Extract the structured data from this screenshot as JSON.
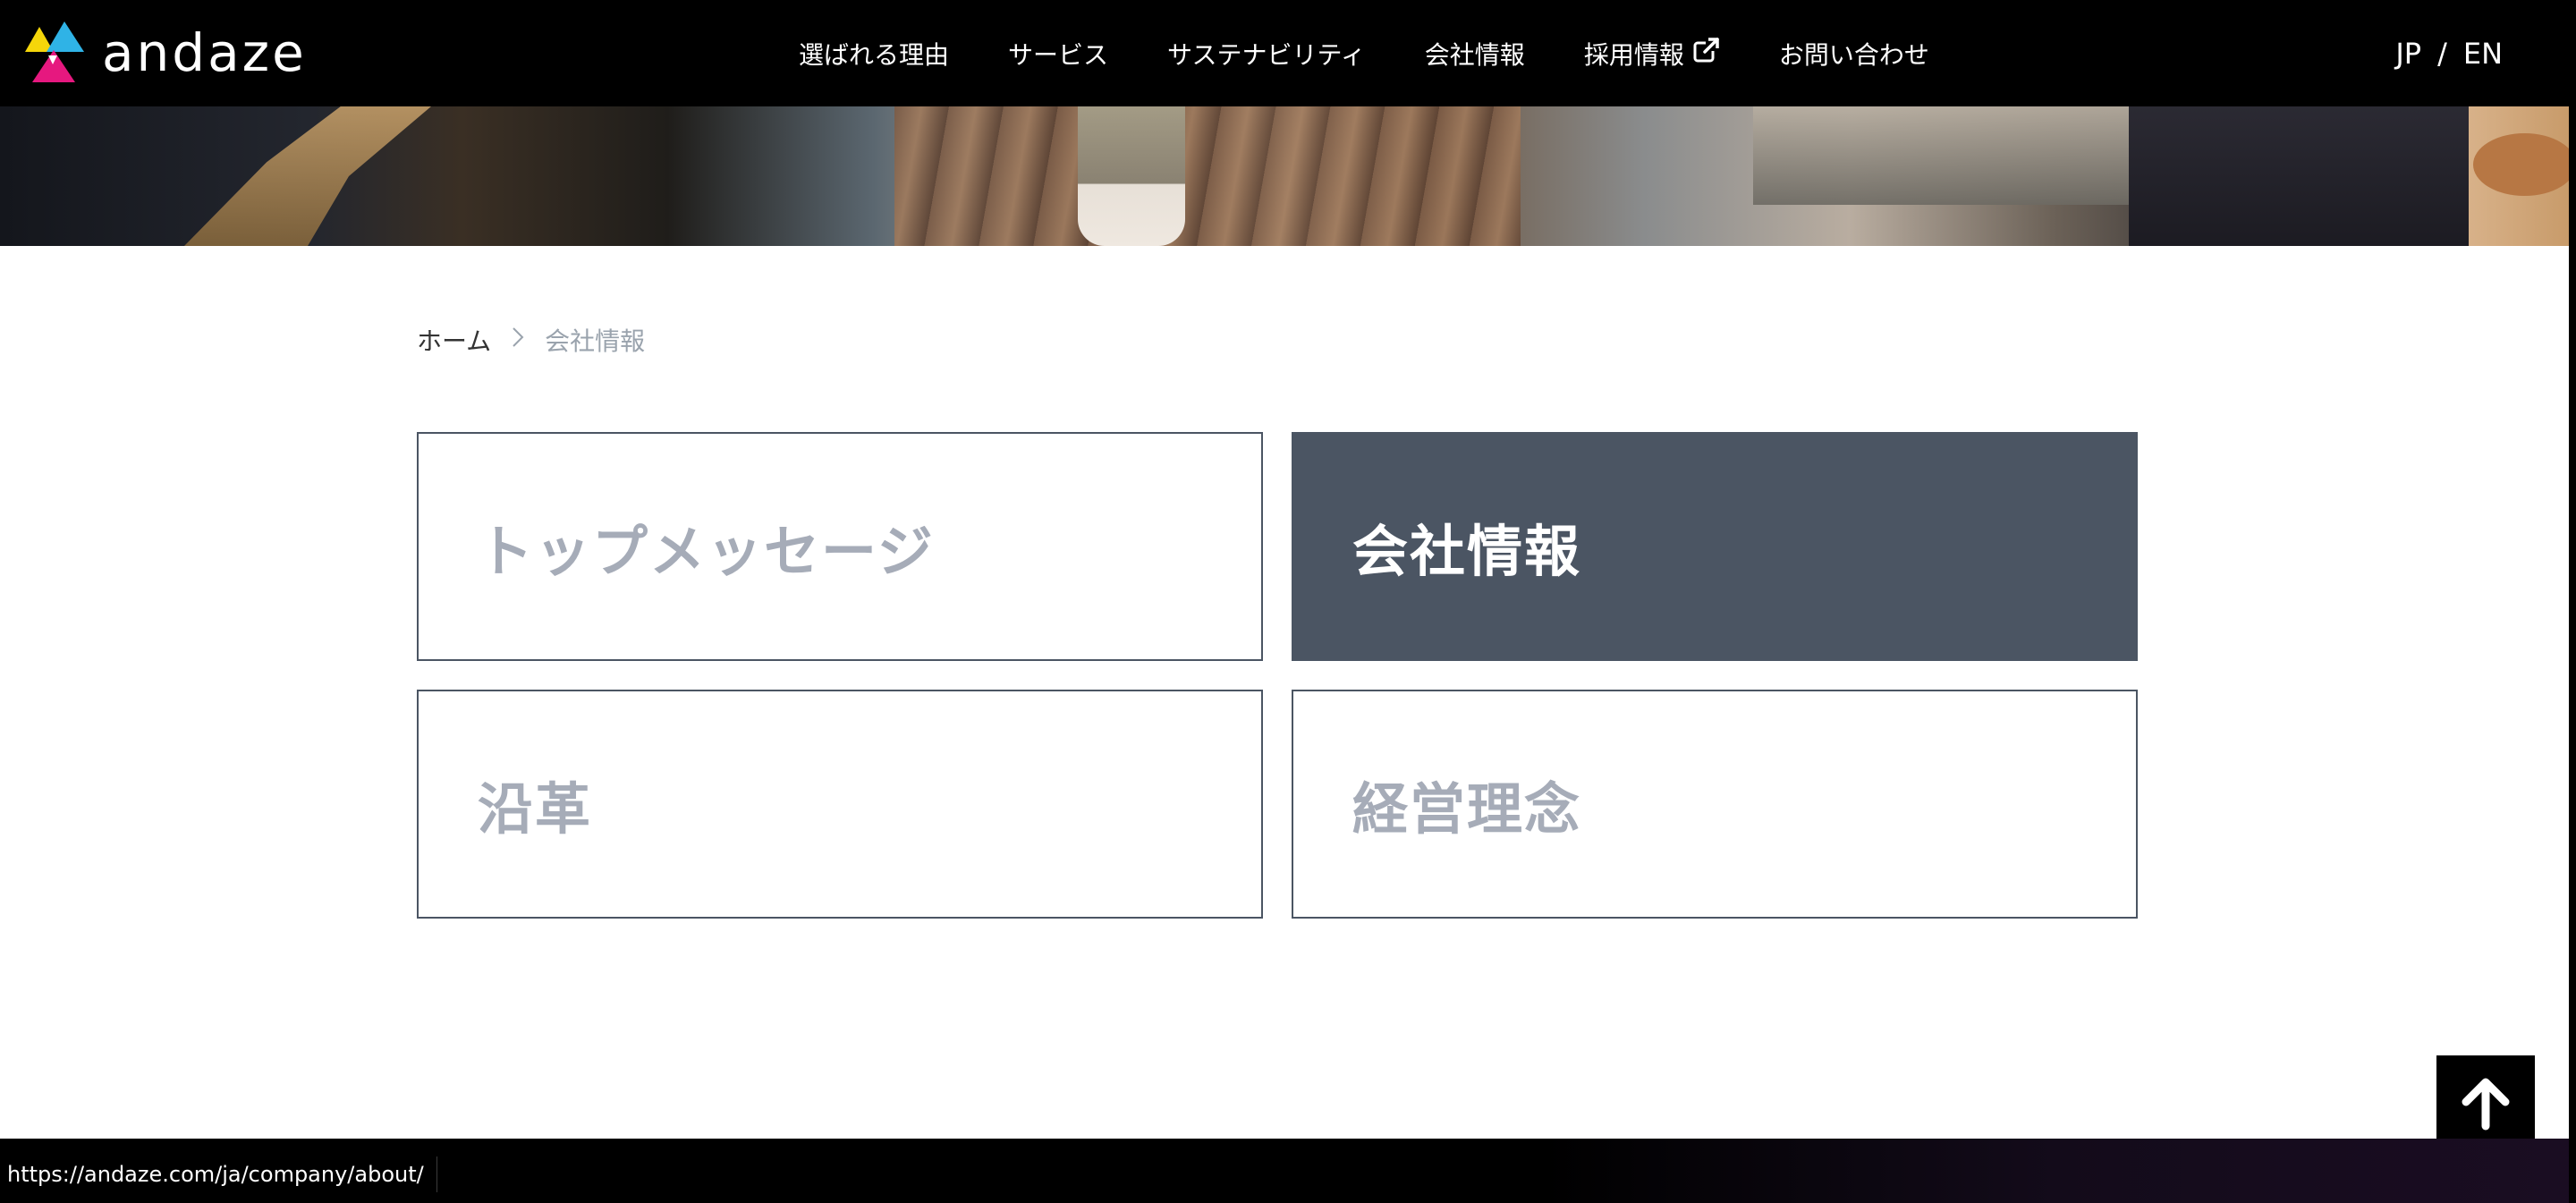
{
  "header": {
    "logo_text": "andaze",
    "nav": [
      {
        "label": "選ばれる理由"
      },
      {
        "label": "サービス"
      },
      {
        "label": "サステナビリティ"
      },
      {
        "label": "会社情報"
      },
      {
        "label": "採用情報",
        "external": true
      },
      {
        "label": "お問い合わせ"
      }
    ],
    "lang": {
      "jp": "JP",
      "separator": "/",
      "en": "EN"
    }
  },
  "breadcrumb": {
    "home": "ホーム",
    "current": "会社情報"
  },
  "cards": [
    {
      "label": "トップメッセージ",
      "active": false
    },
    {
      "label": "会社情報",
      "active": true
    },
    {
      "label": "沿革",
      "active": false
    },
    {
      "label": "経営理念",
      "active": false
    }
  ],
  "status_bar": {
    "url": "https://andaze.com/ja/company/about/"
  },
  "icons": {
    "external": "external-link-icon",
    "chevron": "chevron-right-icon",
    "to_top": "arrow-up-icon"
  },
  "colors": {
    "header_bg": "#000000",
    "card_active_bg": "#4b5563",
    "card_text": "#a6acb8",
    "breadcrumb_current": "#9aa3ad"
  }
}
